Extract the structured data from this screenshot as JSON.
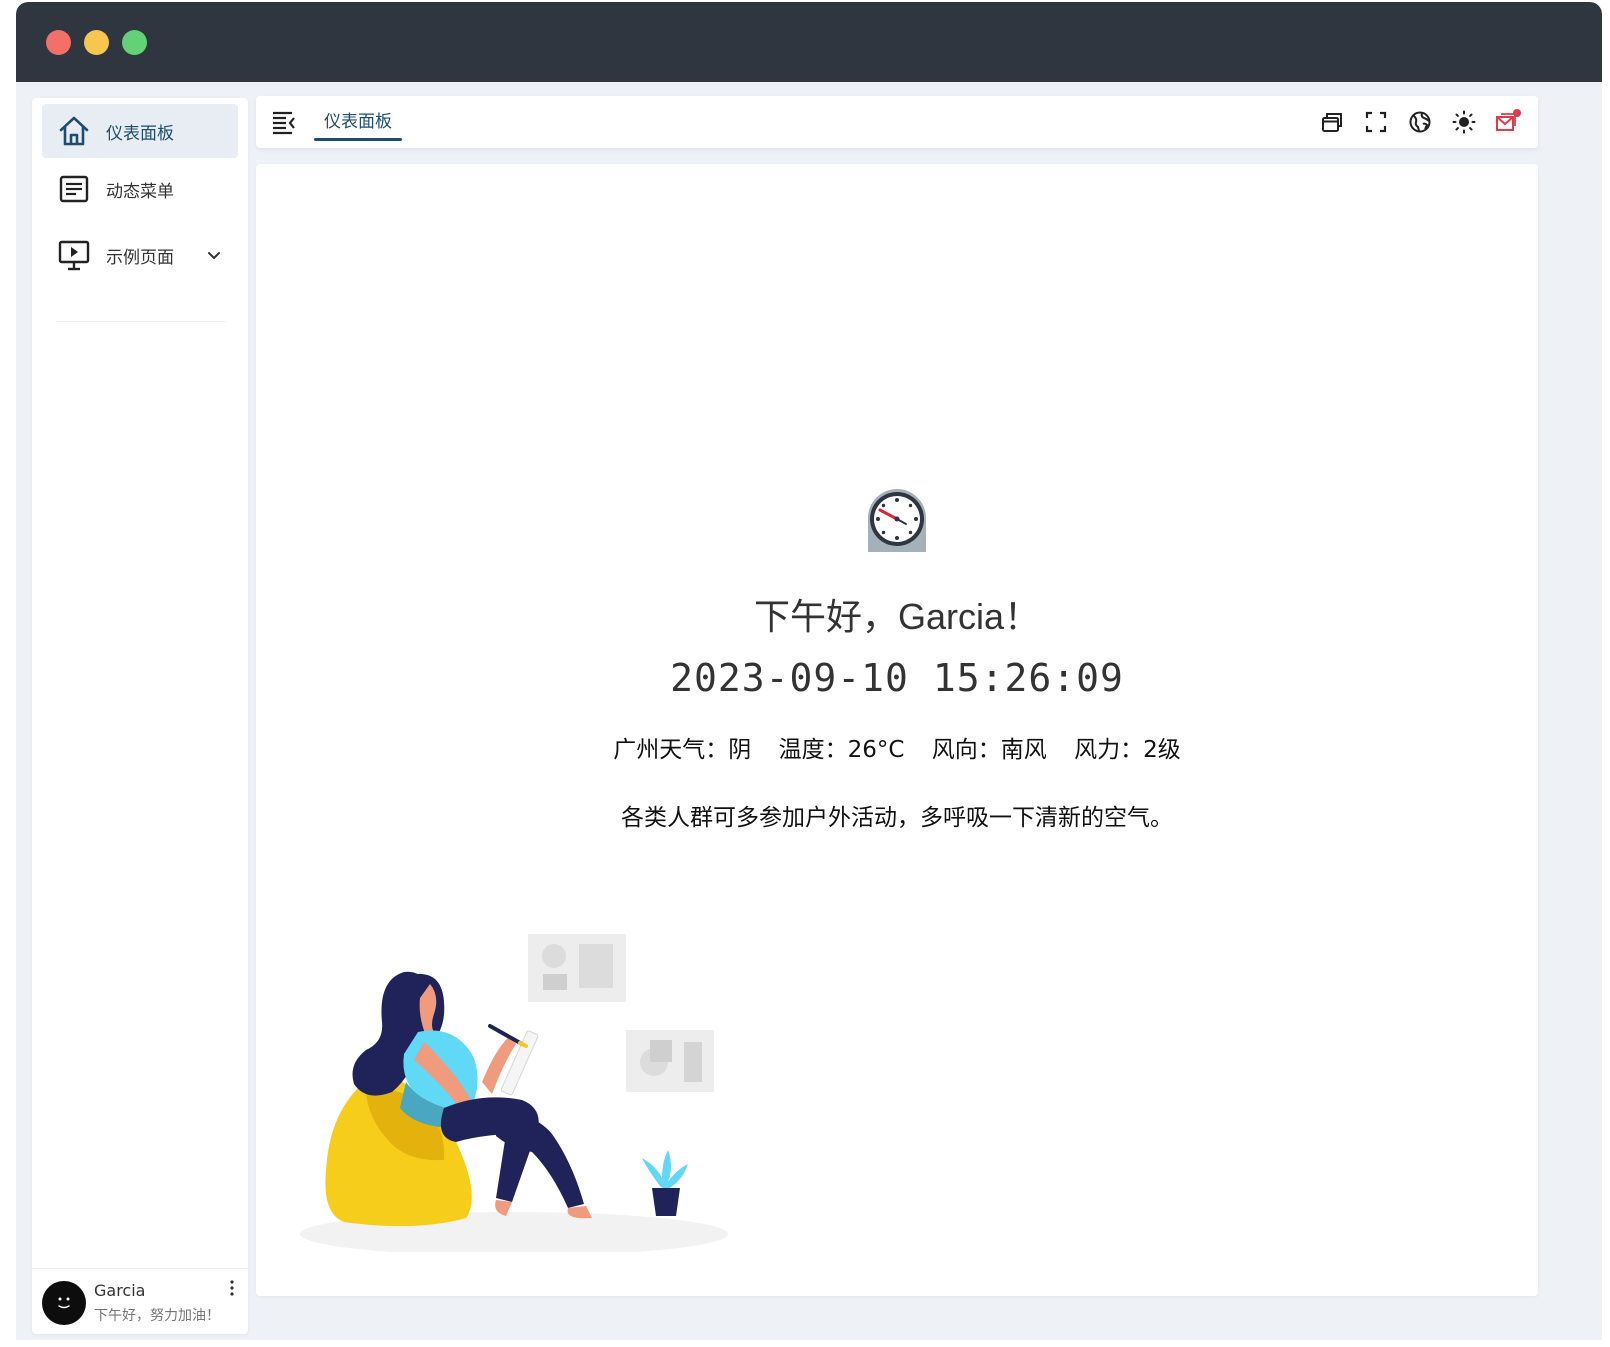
{
  "sidebar": {
    "items": [
      {
        "label": "仪表面板",
        "icon": "home-icon",
        "active": true
      },
      {
        "label": "动态菜单",
        "icon": "document-list-icon",
        "active": false
      },
      {
        "label": "示例页面",
        "icon": "monitor-play-icon",
        "active": false,
        "expandable": true
      }
    ],
    "user": {
      "name": "Garcia",
      "subtitle": "下午好，努力加油！"
    }
  },
  "topbar": {
    "tabs": [
      {
        "label": "仪表面板",
        "active": true
      }
    ],
    "icons": [
      "window-restore-icon",
      "fullscreen-icon",
      "globe-icon",
      "sun-icon",
      "mail-notification-icon"
    ]
  },
  "dashboard": {
    "greeting": "下午好，Garcia！",
    "datetime": "2023-09-10 15:26:09",
    "weather": {
      "city": "广州天气：阴",
      "temperature": "温度：26°C",
      "wind_direction": "风向：南风",
      "wind_force": "风力：2级"
    },
    "advice": "各类人群可多参加户外活动，多呼吸一下清新的空气。"
  },
  "colors": {
    "accent": "#1e4d6e",
    "titlebar": "#2f3640",
    "notification": "#e33a4b"
  }
}
